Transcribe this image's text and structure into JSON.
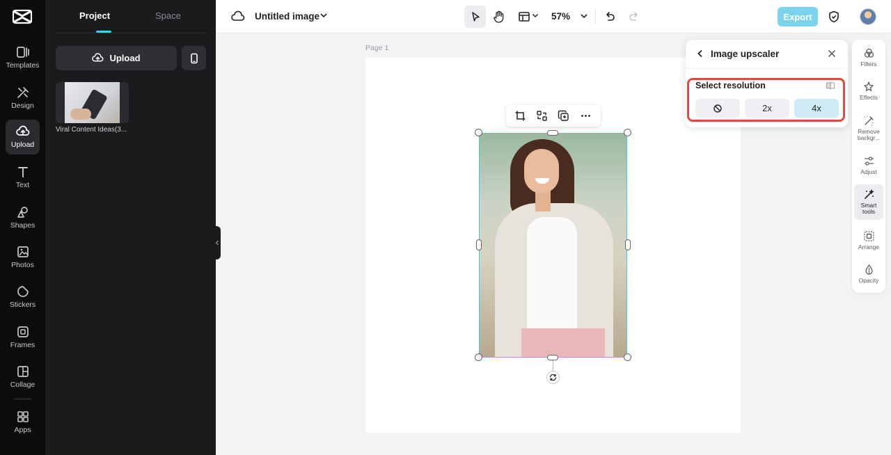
{
  "rail": {
    "items": [
      {
        "label": "Templates",
        "icon": "templates-icon"
      },
      {
        "label": "Design",
        "icon": "design-icon"
      },
      {
        "label": "Upload",
        "icon": "upload-cloud-icon"
      },
      {
        "label": "Text",
        "icon": "text-icon"
      },
      {
        "label": "Shapes",
        "icon": "shapes-icon"
      },
      {
        "label": "Photos",
        "icon": "photos-icon"
      },
      {
        "label": "Stickers",
        "icon": "stickers-icon"
      },
      {
        "label": "Frames",
        "icon": "frames-icon"
      },
      {
        "label": "Collage",
        "icon": "collage-icon"
      },
      {
        "label": "Apps",
        "icon": "apps-icon"
      }
    ]
  },
  "panel": {
    "tabs": [
      "Project",
      "Space"
    ],
    "upload_label": "Upload",
    "thumb_caption": "Viral Content Ideas(3..."
  },
  "topbar": {
    "doc_title": "Untitled image",
    "zoom": "57%",
    "export_label": "Export"
  },
  "canvas": {
    "page_label": "Page 1"
  },
  "upscaler": {
    "title": "Image upscaler",
    "select_label": "Select resolution",
    "options": [
      "2x",
      "4x"
    ],
    "selected": "4x",
    "highlight_color": "#e24b3b"
  },
  "right_tools": [
    {
      "label": "Filters",
      "icon": "filters-icon"
    },
    {
      "label": "Effects",
      "icon": "effects-icon"
    },
    {
      "label": "Remove backgr...",
      "icon": "remove-background-icon"
    },
    {
      "label": "Adjust",
      "icon": "adjust-icon"
    },
    {
      "label": "Smart tools",
      "icon": "smart-tools-icon"
    },
    {
      "label": "Arrange",
      "icon": "arrange-icon"
    },
    {
      "label": "Opacity",
      "icon": "opacity-icon"
    }
  ],
  "colors": {
    "accent": "#3ed0ee",
    "export_bg": "#7cd3ee",
    "selection_border": "#3ecbe4"
  }
}
